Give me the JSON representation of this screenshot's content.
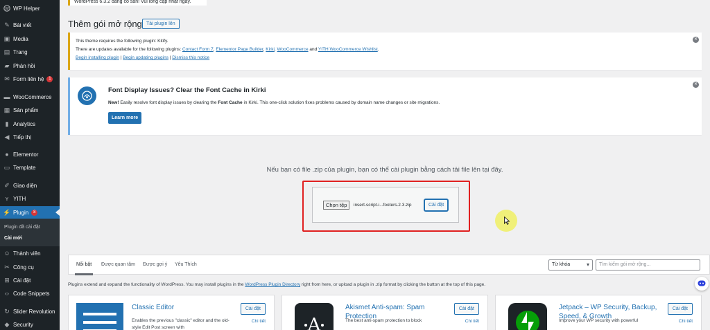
{
  "sidebar": {
    "brand": "WP Helper",
    "items": [
      {
        "label": "Bài viết",
        "icon": "pin-icon"
      },
      {
        "label": "Media",
        "icon": "media-icon"
      },
      {
        "label": "Trang",
        "icon": "page-icon"
      },
      {
        "label": "Phản hồi",
        "icon": "comment-icon"
      },
      {
        "label": "Form liên hệ",
        "icon": "mail-icon",
        "badge": "1"
      },
      {
        "label": "WooCommerce",
        "icon": "woo-icon"
      },
      {
        "label": "Sản phẩm",
        "icon": "box-icon"
      },
      {
        "label": "Analytics",
        "icon": "chart-icon"
      },
      {
        "label": "Tiếp thị",
        "icon": "megaphone-icon"
      },
      {
        "label": "Elementor",
        "icon": "elementor-icon"
      },
      {
        "label": "Template",
        "icon": "folder-icon"
      },
      {
        "label": "Giao diện",
        "icon": "brush-icon"
      },
      {
        "label": "YITH",
        "icon": "yith-icon"
      },
      {
        "label": "Plugin",
        "icon": "plugin-icon",
        "badge": "8"
      },
      {
        "label": "Thành viên",
        "icon": "user-icon"
      },
      {
        "label": "Công cụ",
        "icon": "wrench-icon"
      },
      {
        "label": "Cài đặt",
        "icon": "settings-icon"
      },
      {
        "label": "Code Snippets",
        "icon": "code-icon"
      },
      {
        "label": "Slider Revolution",
        "icon": "slider-icon"
      },
      {
        "label": "Security",
        "icon": "shield-icon"
      }
    ],
    "submenu": [
      "Plugin đã cài đặt",
      "Cài mới"
    ]
  },
  "header": {
    "update_text": "WordPress 6.3.2 đang có sẵn! Vui lòng cập nhật ngay.",
    "title": "Thêm gói mở rộng",
    "upload_button": "Tải plugin lên"
  },
  "notice_tgmpa": {
    "line1": "This theme requires the following plugin: Kitify.",
    "line2_prefix": "There are updates available for the following plugins: ",
    "plugins": [
      "Contact Form 7",
      "Elementor Page Builder",
      "Kirki",
      "WooCommerce",
      "YITH WooCommerce Wishlist"
    ],
    "begin_install": "Begin installing plugin",
    "begin_update": "Begin updating plugins",
    "dismiss": "Dismiss this notice"
  },
  "notice_kirki": {
    "title": "Font Display Issues? Clear the Font Cache in Kirki",
    "new_label": "New!",
    "desc_a": " Easily resolve font display issues by clearing the ",
    "desc_bold": "Font Cache",
    "desc_b": " in Kirki. This one-click solution fixes problems caused by domain name changes or site migrations.",
    "button": "Learn more"
  },
  "upload": {
    "hint": "Nếu bạn có file .zip của plugin, bạn có thể cài plugin bằng cách tải file lên tại đây.",
    "choose_file": "Chọn tệp",
    "file_name": "insert-script-i...footers.2.3.zip",
    "install": "Cài đặt"
  },
  "filter": {
    "tabs": [
      "Nổi bật",
      "Được quan tâm",
      "Được gợi ý",
      "Yêu Thích"
    ],
    "active_tab": "Nổi bật",
    "select_value": "Từ khóa",
    "search_placeholder": "Tìm kiếm gói mở rộng..."
  },
  "intro": {
    "before": "Plugins extend and expand the functionality of WordPress. You may install plugins in the ",
    "link": "WordPress Plugin Directory",
    "after": " right from here, or upload a plugin in .zip format by clicking the button at the top of this page."
  },
  "cards": [
    {
      "title": "Classic Editor",
      "desc": "Enables the previous \"classic\" editor and the old-style Edit Post screen with",
      "install": "Cài đặt",
      "more": "Chi tiết",
      "thumb": "classic-editor-icon"
    },
    {
      "title": "Akismet Anti-spam: Spam Protection",
      "desc": "The best anti-spam protection to block",
      "install": "Cài đặt",
      "more": "Chi tiết",
      "thumb": "akismet-icon"
    },
    {
      "title": "Jetpack – WP Security, Backup, Speed, & Growth",
      "desc": "Improve your WP security with powerful",
      "install": "Cài đặt",
      "more": "Chi tiết",
      "thumb": "jetpack-icon"
    }
  ],
  "colors": {
    "sidebar": "#1d2327",
    "accent": "#2271b1",
    "warning": "#dba617",
    "highlight": "#e02020"
  }
}
